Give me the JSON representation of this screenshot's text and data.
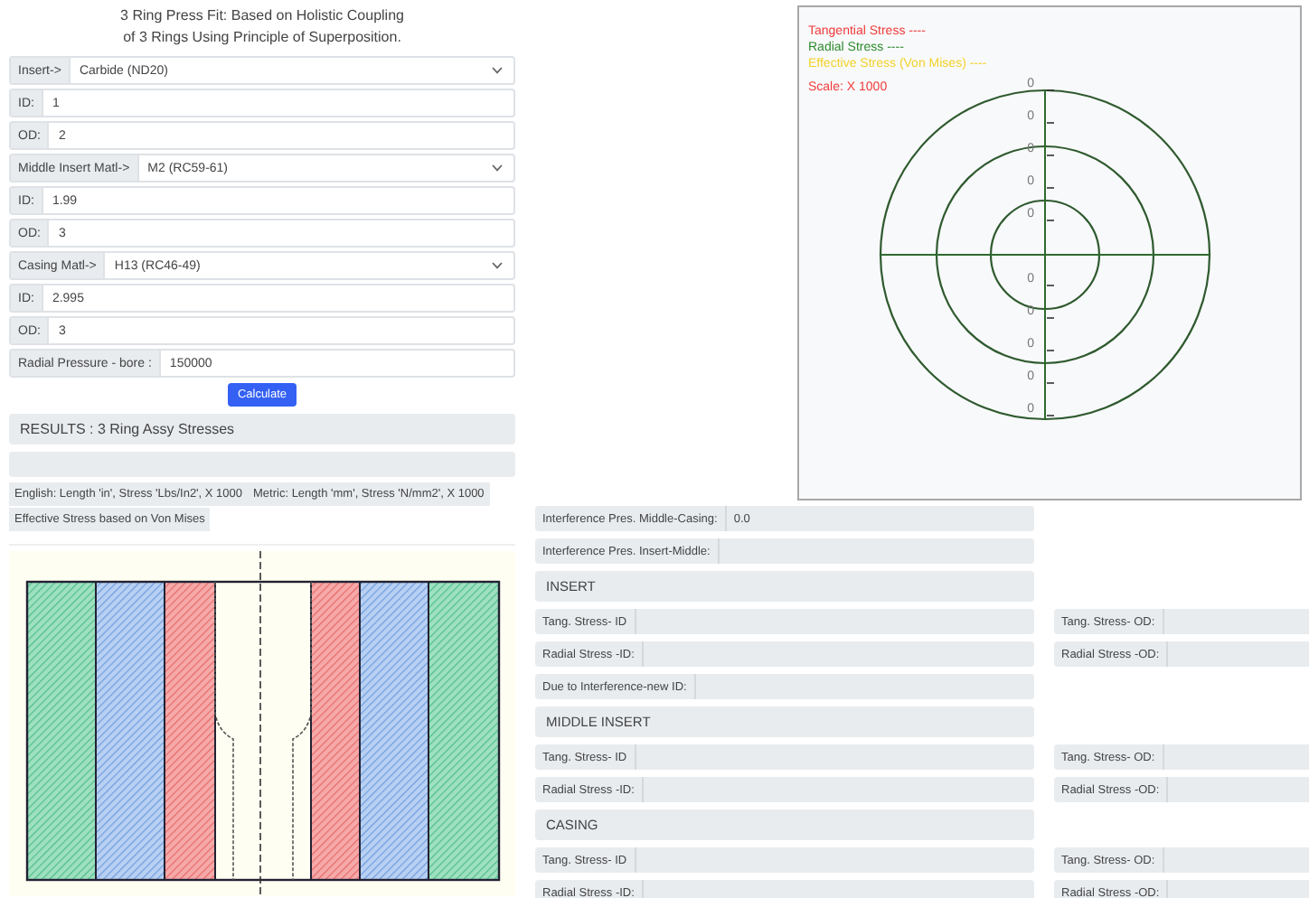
{
  "title": [
    "3 Ring Press Fit: Based on Holistic Coupling",
    "of 3 Rings Using Principle of Superposition."
  ],
  "form": [
    {
      "kind": "select",
      "label": "Insert->",
      "value": "Carbide (ND20)"
    },
    {
      "kind": "input",
      "label": "ID:",
      "value": "1"
    },
    {
      "kind": "input",
      "label": "OD:",
      "value": "2"
    },
    {
      "kind": "select",
      "label": "Middle Insert Matl->",
      "value": "M2 (RC59-61)"
    },
    {
      "kind": "input",
      "label": "ID:",
      "value": "1.99"
    },
    {
      "kind": "input",
      "label": "OD:",
      "value": "3"
    },
    {
      "kind": "select",
      "label": "Casing Matl->",
      "value": "H13 (RC46-49)"
    },
    {
      "kind": "input",
      "label": "ID:",
      "value": "2.995"
    },
    {
      "kind": "input",
      "label": "OD:",
      "value": "3"
    },
    {
      "kind": "input",
      "label": "Radial Pressure - bore :",
      "value": "150000"
    }
  ],
  "button": "Calculate",
  "results_header": "RESULTS : 3 Ring Assy Stresses",
  "units": [
    "English: Length 'in', Stress 'Lbs/In2', X 1000",
    "Metric: Length 'mm', Stress 'N/mm2', X 1000",
    "Effective Stress based on Von Mises"
  ],
  "chart": {
    "legend": [
      {
        "label": "Tangential Stress ----",
        "color": "#f03a3a"
      },
      {
        "label": "Radial Stress ----",
        "color": "#2e8b2e"
      },
      {
        "label": "Effective Stress (Von Mises) ----",
        "color": "#f2d22a"
      }
    ],
    "scale": "Scale: X 1000",
    "tick_labels": [
      "0",
      "0",
      "0",
      "0",
      "0",
      "0",
      "0",
      "0",
      "0",
      "0"
    ]
  },
  "results": [
    {
      "kind": "field",
      "label": "Interference Pres. Middle-Casing:",
      "value": "0.0"
    },
    {
      "kind": "field",
      "label": "Interference Pres. Insert-Middle:"
    },
    {
      "kind": "heading",
      "label": "INSERT"
    },
    {
      "kind": "pair",
      "left": "Tang. Stress- ID",
      "right": "Tang. Stress- OD:"
    },
    {
      "kind": "pair",
      "left": "Radial Stress -ID:",
      "right": "Radial Stress -OD:"
    },
    {
      "kind": "field",
      "label": "Due to Interference-new ID:"
    },
    {
      "kind": "heading",
      "label": "MIDDLE INSERT"
    },
    {
      "kind": "pair",
      "left": "Tang. Stress- ID",
      "right": "Tang. Stress- OD:"
    },
    {
      "kind": "pair",
      "left": "Radial Stress -ID:",
      "right": "Radial Stress -OD:"
    },
    {
      "kind": "heading",
      "label": "CASING"
    },
    {
      "kind": "pair",
      "left": "Tang. Stress- ID",
      "right": "Tang. Stress- OD:"
    },
    {
      "kind": "pair",
      "left": "Radial Stress -ID:",
      "right": "Radial Stress -OD:"
    }
  ]
}
